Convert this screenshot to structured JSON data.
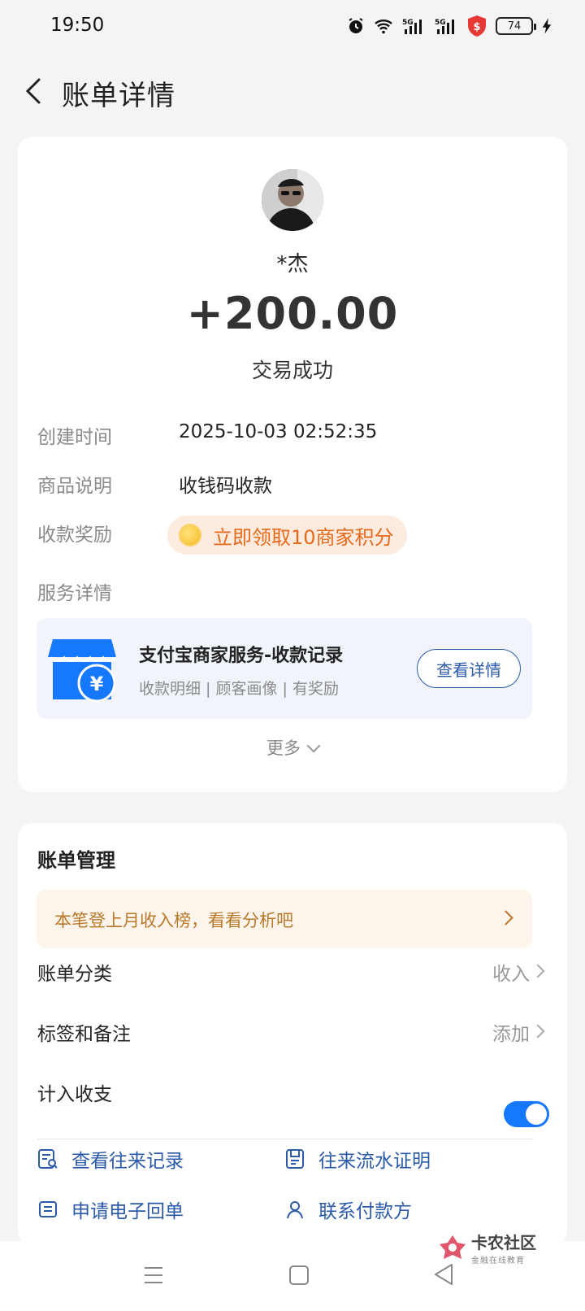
{
  "status_bar": {
    "time": "19:50",
    "battery": "74",
    "icons": [
      "alarm-icon",
      "wifi-icon",
      "signal-5g-icon",
      "signal-5g-icon",
      "security-shield-icon",
      "battery-icon",
      "charging-icon"
    ]
  },
  "header": {
    "title": "账单详情",
    "back_icon": "chevron-left-icon"
  },
  "transaction": {
    "payer_name": "*杰",
    "amount": "+200.00",
    "status": "交易成功",
    "details": [
      {
        "label": "创建时间",
        "value": "2025-10-03 02:52:35"
      },
      {
        "label": "商品说明",
        "value": "收钱码收款"
      }
    ],
    "reward_label": "收款奖励",
    "reward_text": "立即领取10商家积分",
    "service_label": "服务详情",
    "service": {
      "title": "支付宝商家服务-收款记录",
      "subtitle": "收款明细 | 顾客画像 | 有奖励",
      "button": "查看详情"
    },
    "more": "更多"
  },
  "bill_management": {
    "title": "账单管理",
    "insight": "本笔登上月收入榜，看看分析吧",
    "rows": [
      {
        "label": "账单分类",
        "value": "收入"
      },
      {
        "label": "标签和备注",
        "value": "添加"
      }
    ],
    "toggle_label": "计入收支",
    "toggle_on": true,
    "actions": [
      {
        "label": "查看往来记录",
        "icon": "record-search-icon"
      },
      {
        "label": "往来流水证明",
        "icon": "document-icon"
      },
      {
        "label": "申请电子回单",
        "icon": "receipt-icon"
      },
      {
        "label": "联系付款方",
        "icon": "contact-icon"
      }
    ]
  },
  "watermark": {
    "title": "卡农社区",
    "subtitle": "金融在线教育"
  },
  "colors": {
    "accent_blue": "#1677ff",
    "link_blue": "#2b5ba8",
    "reward_orange": "#e76a1a",
    "insight_brown": "#b9782a"
  }
}
